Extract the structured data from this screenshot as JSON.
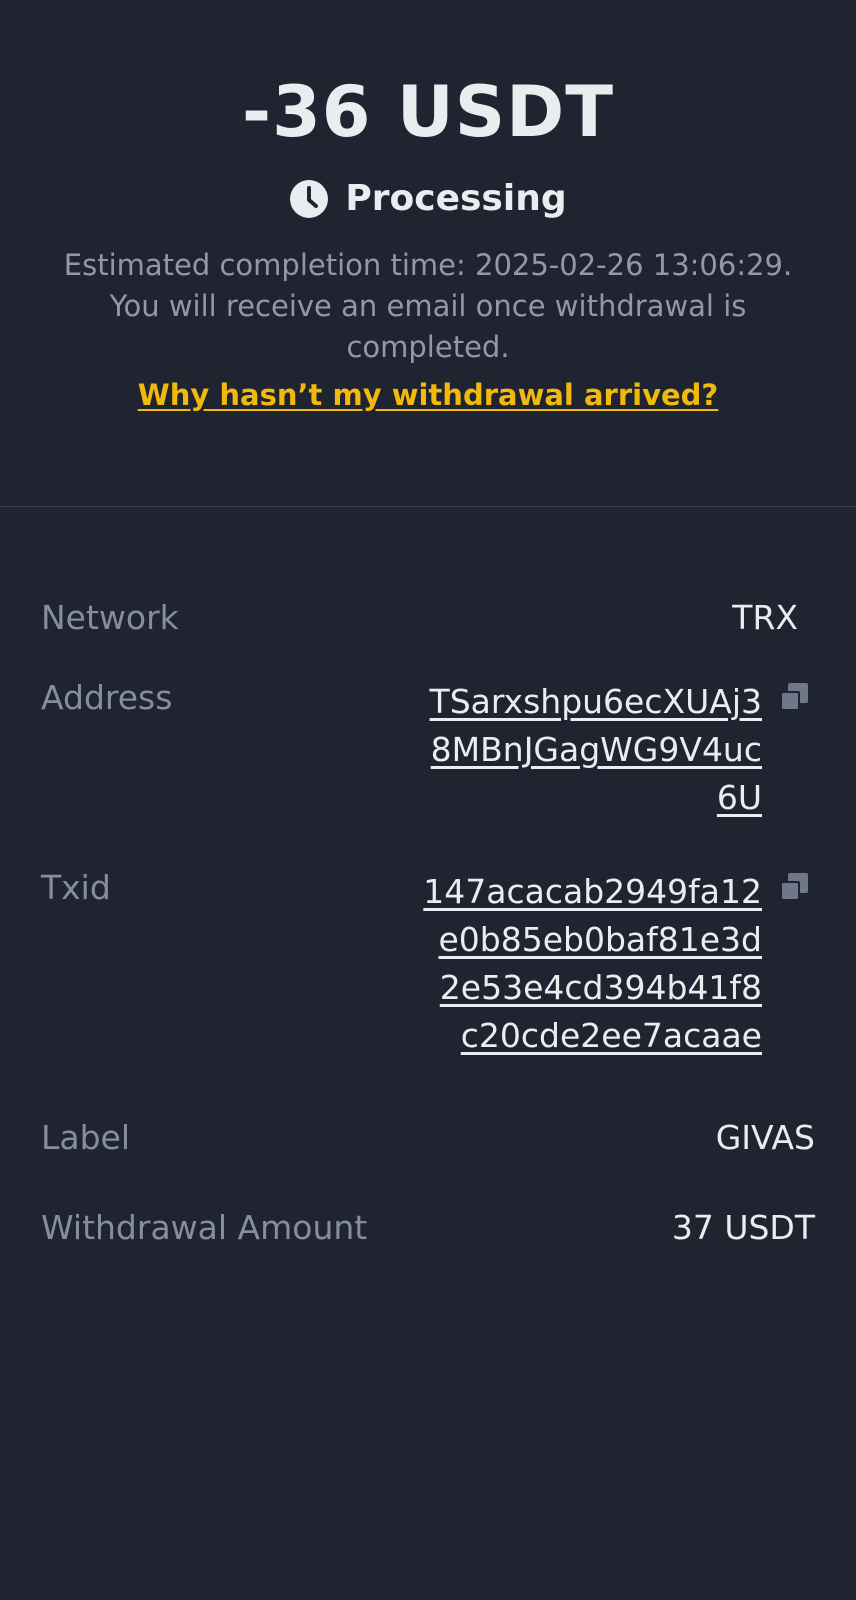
{
  "summary": {
    "amount": "-36 USDT",
    "status": "Processing",
    "estimate_text": "Estimated completion time: 2025-02-26 13:06:29. You will receive an email once withdrawal is completed.",
    "help_link": "Why hasn’t my withdrawal arrived?"
  },
  "details": {
    "network": {
      "label": "Network",
      "value": "TRX"
    },
    "address": {
      "label": "Address",
      "value": "TSarxshpu6ecXUAj38MBnJGagWG9V4uc6U"
    },
    "txid": {
      "label": "Txid",
      "value": "147acacab2949fa12e0b85eb0baf81e3d2e53e4cd394b41f8c20cde2ee7acaae"
    },
    "label": {
      "label": "Label",
      "value": "GIVAS"
    },
    "withdrawal_amount": {
      "label": "Withdrawal Amount",
      "value": "37 USDT"
    }
  },
  "icons": {
    "status": "clock-icon",
    "copy": "copy-icon"
  },
  "colors": {
    "background": "#1f2430",
    "primary_text": "#eaecef",
    "secondary_text": "#848e9c",
    "link": "#f0b90b",
    "divider": "#3a404b"
  }
}
